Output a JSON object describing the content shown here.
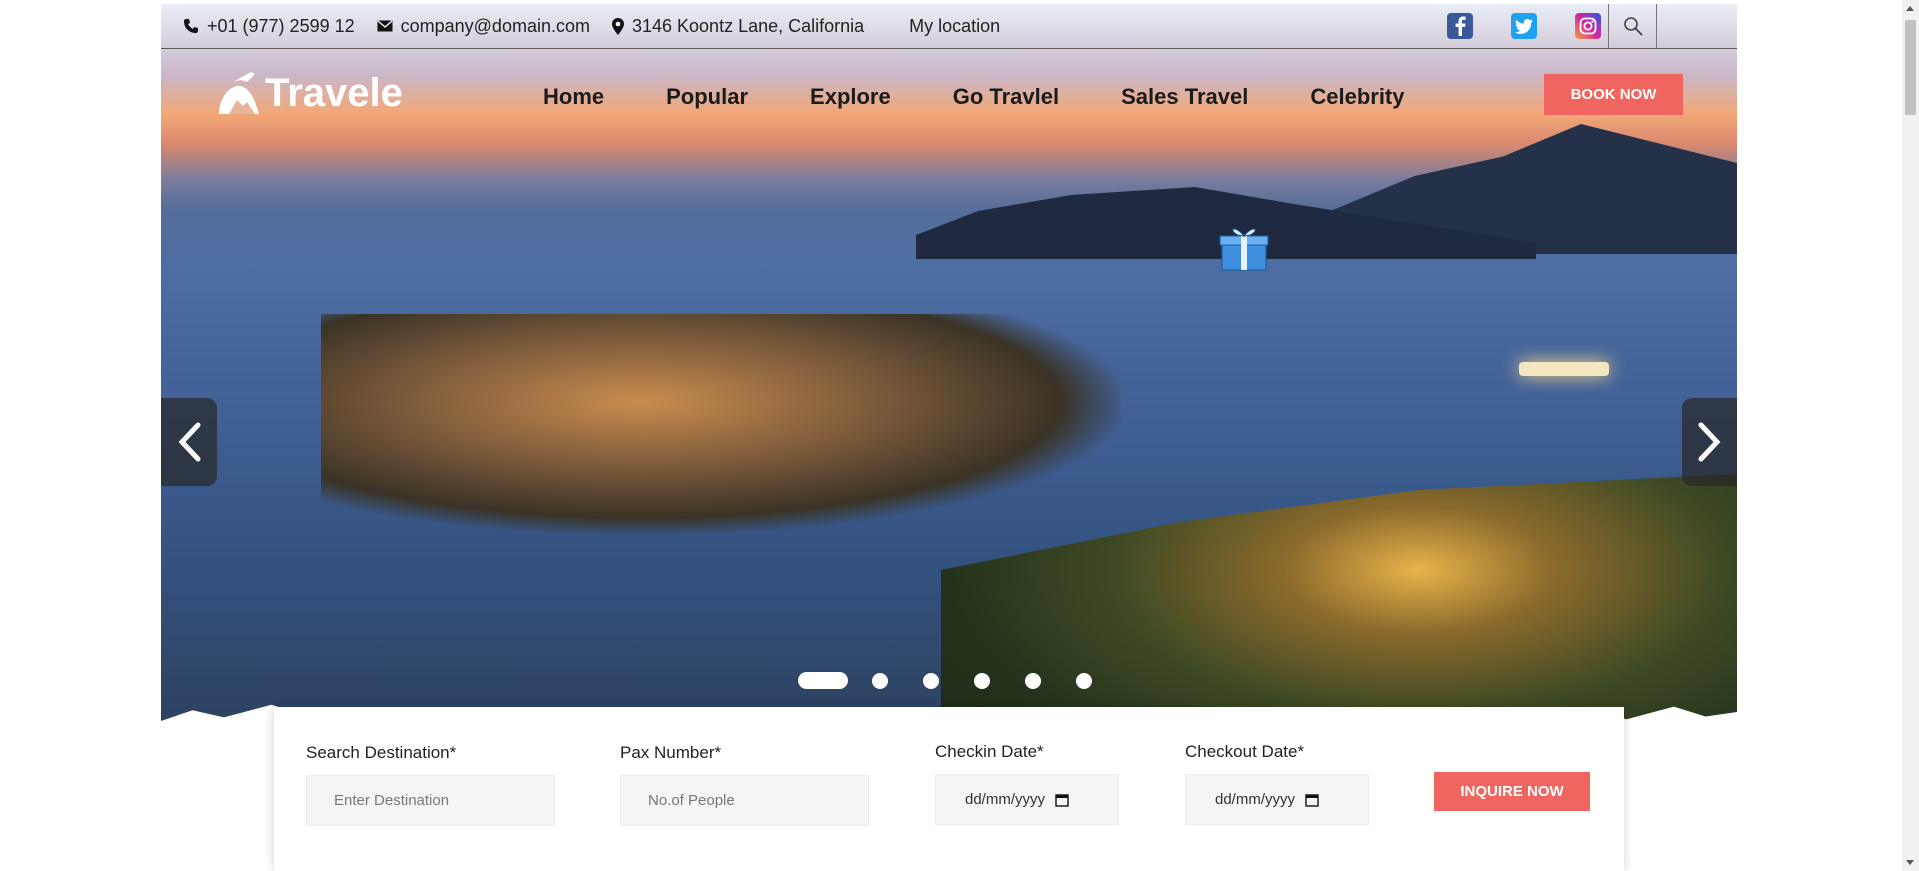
{
  "topbar": {
    "phone": "+01 (977) 2599 12",
    "email": "company@domain.com",
    "address": "3146 Koontz Lane, California",
    "location_link": "My location",
    "socials": [
      "facebook-icon",
      "twitter-icon",
      "instagram-icon"
    ],
    "search_icon": "search-icon"
  },
  "brand": {
    "logo_text": "Travele"
  },
  "nav": {
    "items": [
      "Home",
      "Popular",
      "Explore",
      "Go Travlel",
      "Sales Travel",
      "Celebrity"
    ]
  },
  "header": {
    "book_label": "BOOK NOW"
  },
  "slider": {
    "slides": 6,
    "active_index": 0,
    "prev_icon": "chevron-left-icon",
    "next_icon": "chevron-right-icon"
  },
  "form": {
    "destination_label": "Search Destination*",
    "destination_placeholder": "Enter Destination",
    "pax_label": "Pax Number*",
    "pax_placeholder": "No.of People",
    "checkin_label": "Checkin Date*",
    "checkin_value": "dd/mm/yyyy",
    "checkout_label": "Checkout Date*",
    "checkout_value": "dd/mm/yyyy",
    "submit_label": "INQUIRE NOW"
  },
  "colors": {
    "accent": "#f0655f",
    "facebook": "#3b5998",
    "twitter": "#1da1f2",
    "instagram": "#c13584"
  }
}
